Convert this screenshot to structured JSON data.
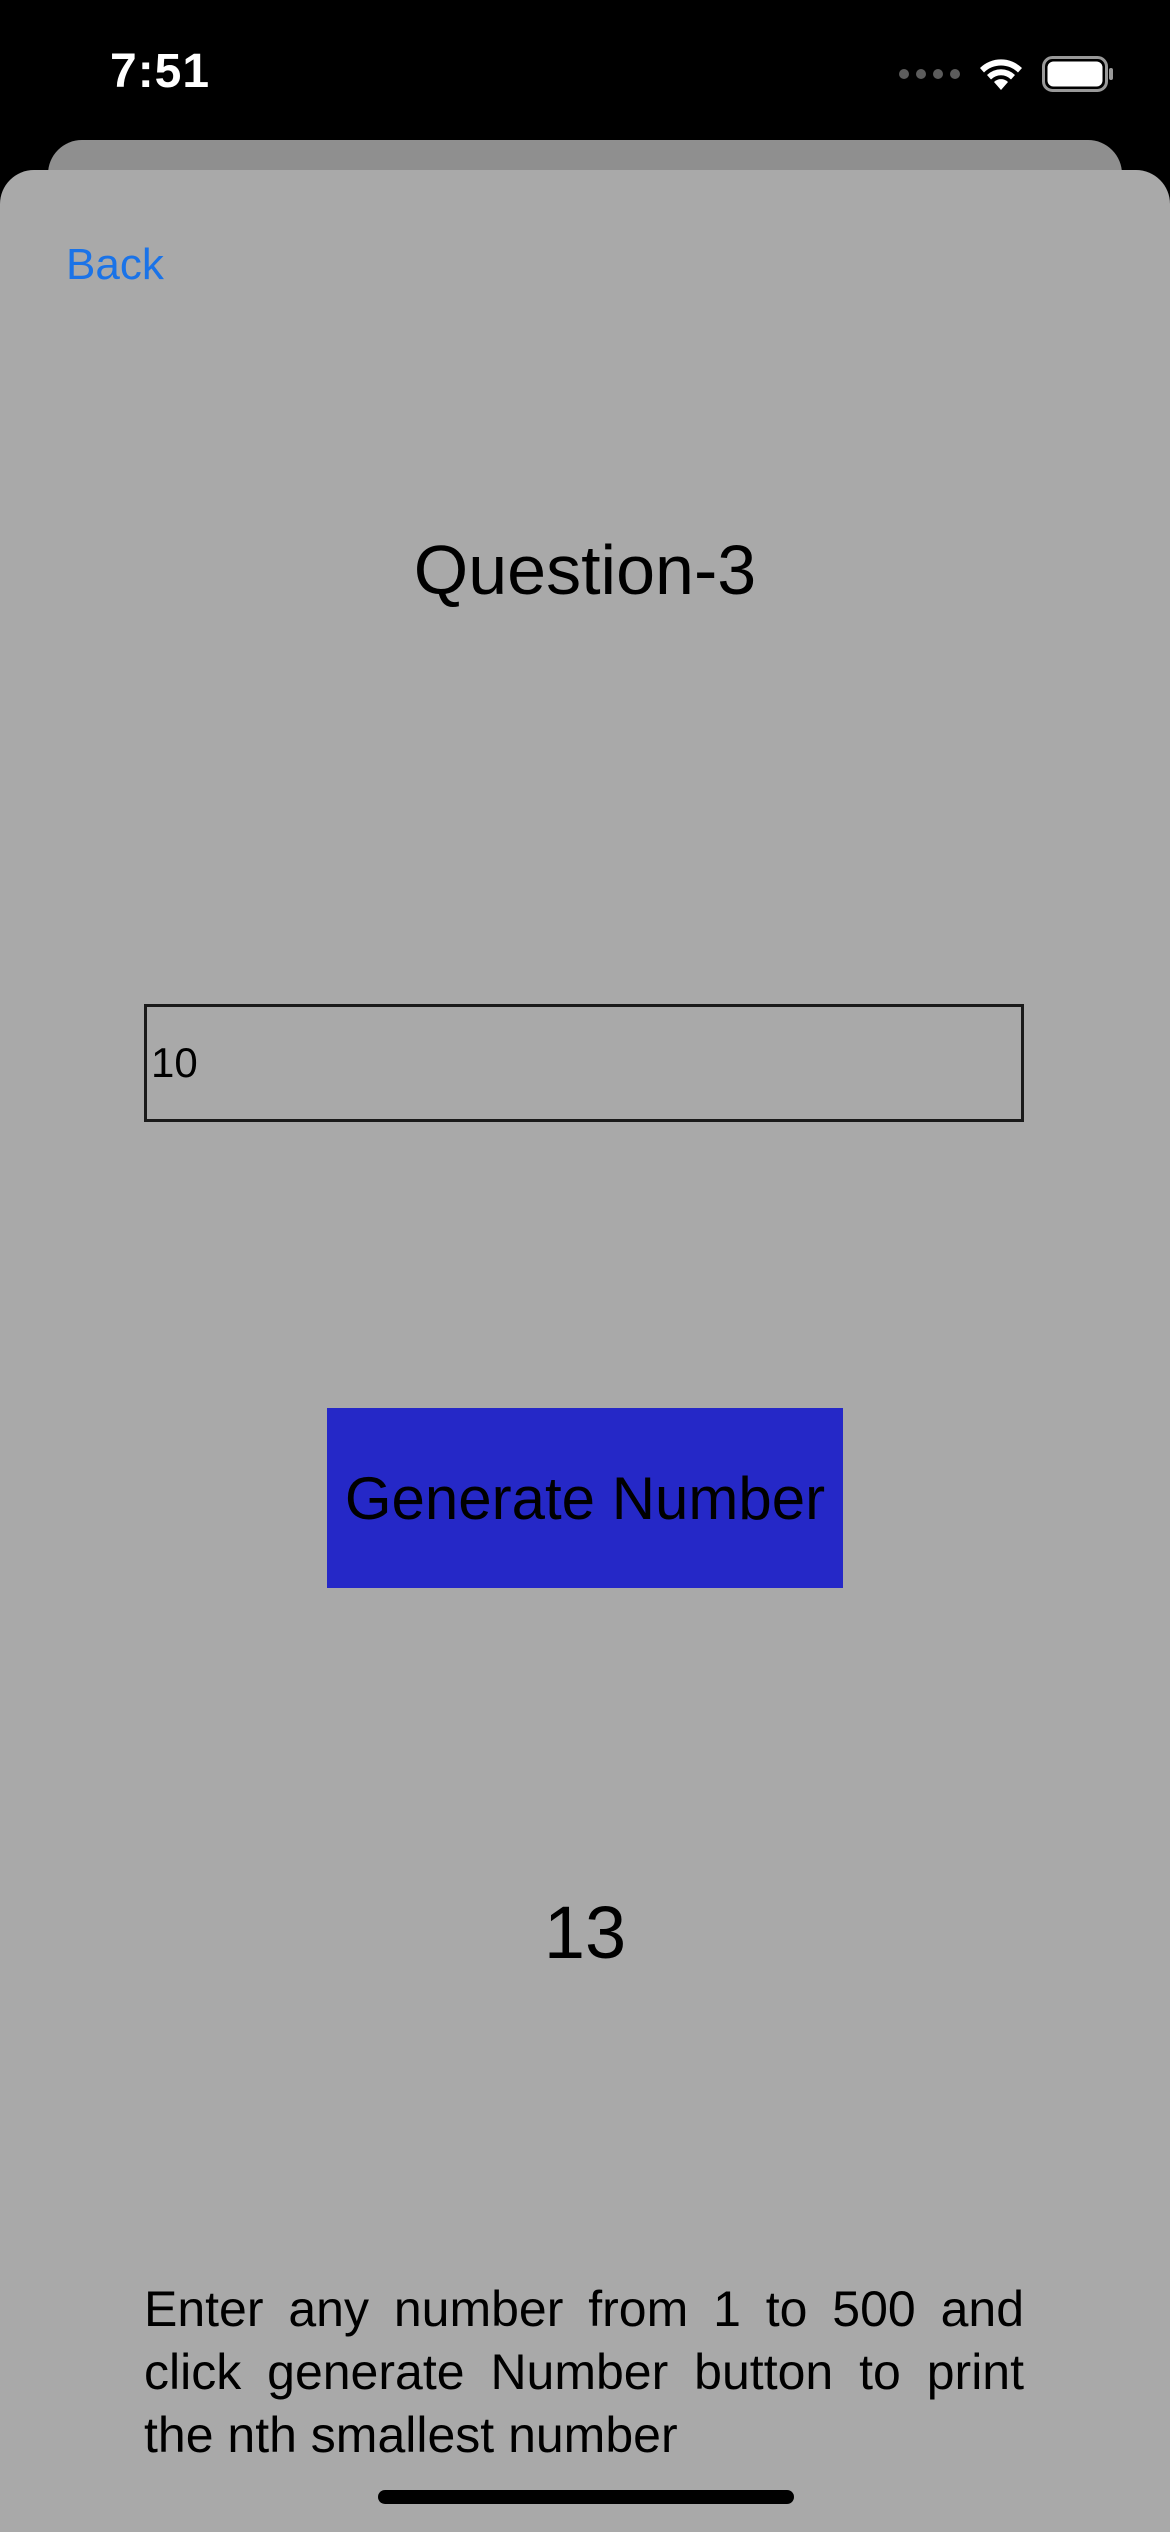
{
  "status_bar": {
    "time": "7:51",
    "icons": [
      "cellular-signal-icon",
      "wifi-icon",
      "battery-icon"
    ]
  },
  "nav": {
    "back_label": "Back"
  },
  "main": {
    "title": "Question-3",
    "input": {
      "value": "10",
      "placeholder": ""
    },
    "generate_button_label": "Generate Number",
    "result": "13",
    "instructions": "Enter any number from 1 to 500 and click generate Number button to print the nth smallest number"
  },
  "colors": {
    "accent_link": "#1a73e8",
    "button_bg": "#2528c7",
    "sheet_bg": "#a9a9a9",
    "status_bar_bg": "#000000"
  }
}
